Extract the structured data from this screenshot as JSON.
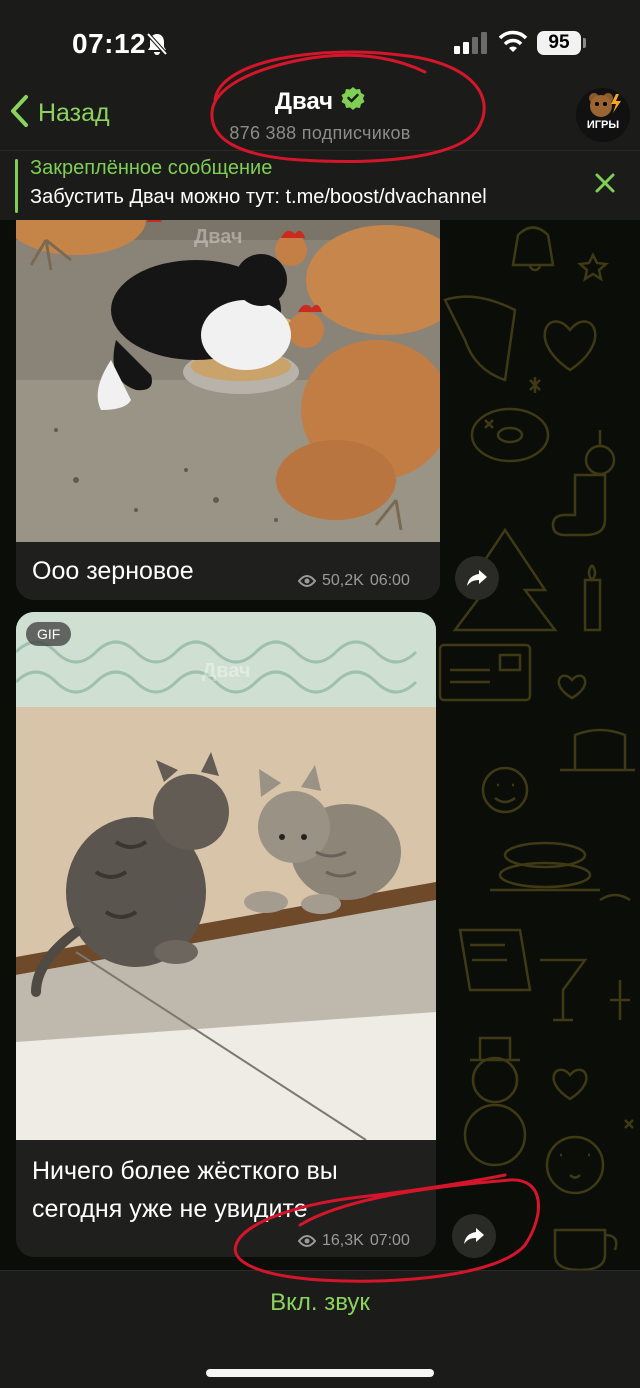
{
  "status_bar": {
    "time": "07:12",
    "battery": "95",
    "icons": [
      "bell-slash-icon",
      "cellular-signal-icon",
      "wifi-icon",
      "battery-icon"
    ]
  },
  "header": {
    "back_label": "Назад",
    "title": "Двач",
    "subtitle": "876 388 подписчиков",
    "avatar_text": "ИГРЫ"
  },
  "pinned": {
    "title": "Закреплённое сообщение",
    "text": "Забустить Двач можно тут: t.me/boost/dvachannel"
  },
  "messages": [
    {
      "caption": "Ооо зерновое",
      "views": "50,2K",
      "time": "06:00",
      "watermark": "Двач",
      "media": "video-cat-with-chickens"
    },
    {
      "badge": "GIF",
      "caption_line1": "Ничего более жёсткого вы",
      "caption_line2": "сегодня уже не увидите",
      "views": "16,3K",
      "time": "07:00",
      "watermark": "Двач",
      "media": "gif-two-kittens"
    }
  ],
  "bottom": {
    "sound_label": "Вкл. звук"
  },
  "colors": {
    "accent": "#8bd35f",
    "header_bg": "#1b1c19",
    "bubble_bg": "#1f1f1d",
    "annotation_red": "#d5162a"
  }
}
